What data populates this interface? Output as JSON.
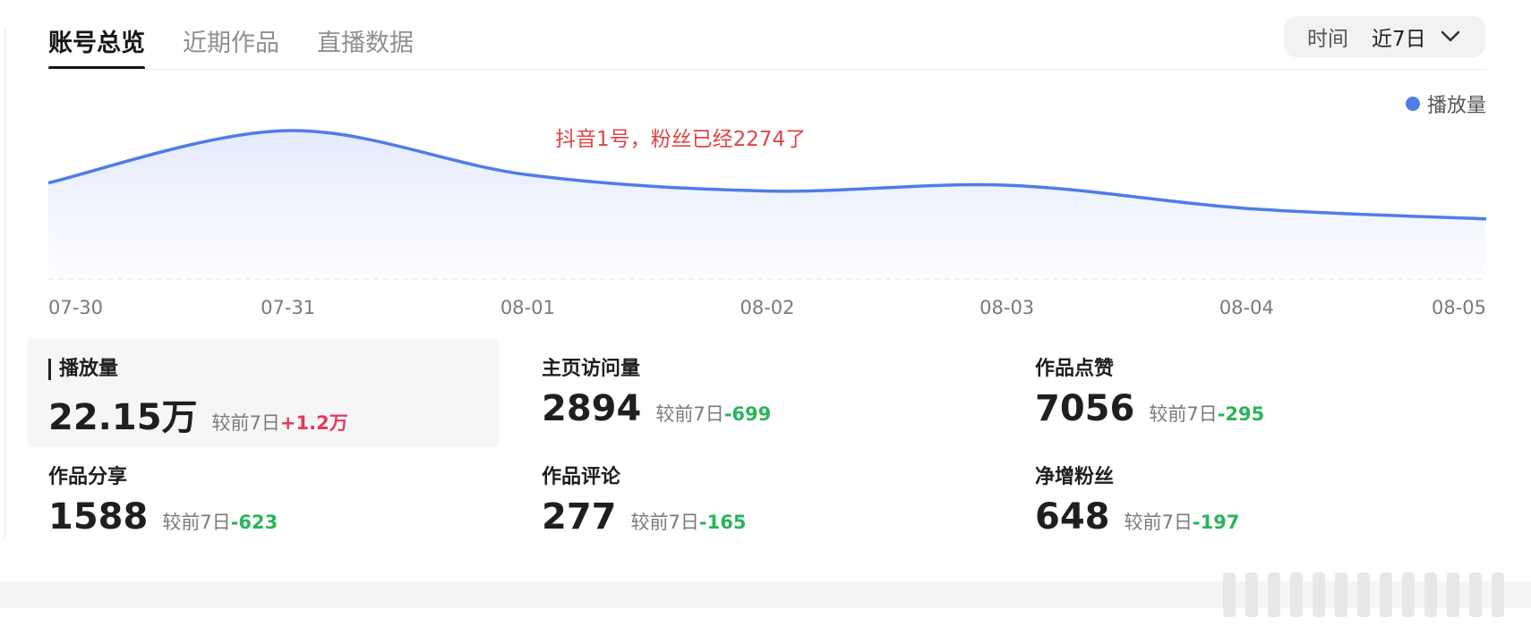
{
  "tabs": [
    {
      "label": "账号总览",
      "active": true
    },
    {
      "label": "近期作品",
      "active": false
    },
    {
      "label": "直播数据",
      "active": false
    }
  ],
  "time_filter": {
    "label": "时间",
    "value": "近7日",
    "icon": "chevron-down-icon"
  },
  "chart": {
    "annotation": "抖音1号，粉丝已经2274了",
    "line_color": "#4f7ce8"
  },
  "chart_data": {
    "type": "area",
    "x": [
      "07-30",
      "07-31",
      "08-01",
      "08-02",
      "08-03",
      "08-04",
      "08-05"
    ],
    "series": [
      {
        "name": "播放量",
        "values": [
          0.55,
          1.0,
          0.62,
          0.48,
          0.53,
          0.33,
          0.24
        ]
      }
    ],
    "legend": "top-right",
    "grid": false
  },
  "metrics": [
    {
      "title": "播放量",
      "value": "22.15万",
      "compare": "较前7日",
      "delta": "+1.2万",
      "trend": "up",
      "selected": true
    },
    {
      "title": "主页访问量",
      "value": "2894",
      "compare": "较前7日",
      "delta": "-699",
      "trend": "down",
      "selected": false
    },
    {
      "title": "作品点赞",
      "value": "7056",
      "compare": "较前7日",
      "delta": "-295",
      "trend": "down",
      "selected": false
    },
    {
      "title": "作品分享",
      "value": "1588",
      "compare": "较前7日",
      "delta": "-623",
      "trend": "down",
      "selected": false
    },
    {
      "title": "作品评论",
      "value": "277",
      "compare": "较前7日",
      "delta": "-165",
      "trend": "down",
      "selected": false
    },
    {
      "title": "净增粉丝",
      "value": "648",
      "compare": "较前7日",
      "delta": "-197",
      "trend": "down",
      "selected": false
    }
  ],
  "colors": {
    "accent": "#4f7ce8",
    "up": "#e33b57",
    "down": "#2bb55a"
  }
}
